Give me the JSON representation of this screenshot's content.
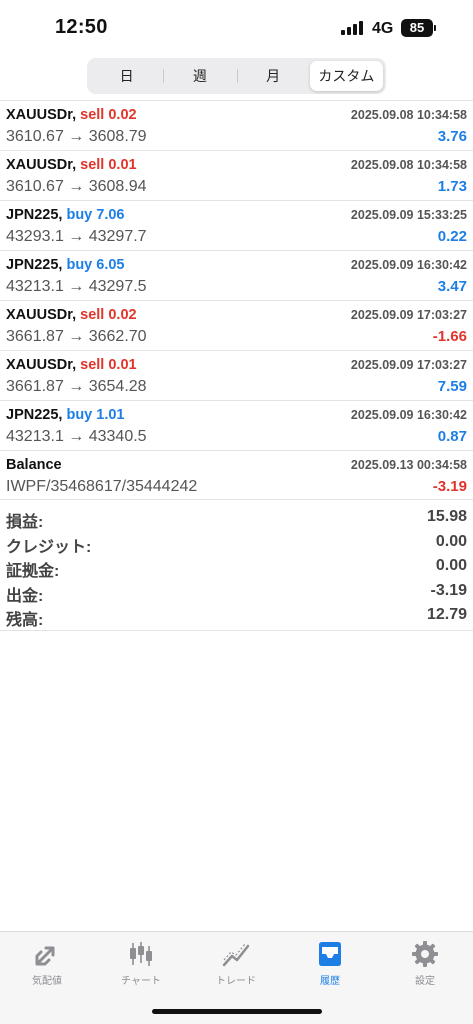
{
  "status": {
    "time": "12:50",
    "network": "4G",
    "battery": "85"
  },
  "period_tabs": [
    "日",
    "週",
    "月",
    "カスタム"
  ],
  "active_period": "カスタム",
  "deals": [
    {
      "symbol": "XAUUSDr,",
      "side": "sell 0.02",
      "side_type": "sell",
      "time": "2025.09.08 10:34:58",
      "prices": "3610.67 → 3608.79",
      "profit": "3.76",
      "profit_sign": "pos"
    },
    {
      "symbol": "XAUUSDr,",
      "side": "sell 0.01",
      "side_type": "sell",
      "time": "2025.09.08 10:34:58",
      "prices": "3610.67 → 3608.94",
      "profit": "1.73",
      "profit_sign": "pos"
    },
    {
      "symbol": "JPN225,",
      "side": "buy 7.06",
      "side_type": "buy",
      "time": "2025.09.09 15:33:25",
      "prices": "43293.1 → 43297.7",
      "profit": "0.22",
      "profit_sign": "pos"
    },
    {
      "symbol": "JPN225,",
      "side": "buy 6.05",
      "side_type": "buy",
      "time": "2025.09.09 16:30:42",
      "prices": "43213.1 → 43297.5",
      "profit": "3.47",
      "profit_sign": "pos"
    },
    {
      "symbol": "XAUUSDr,",
      "side": "sell 0.02",
      "side_type": "sell",
      "time": "2025.09.09 17:03:27",
      "prices": "3661.87 → 3662.70",
      "profit": "-1.66",
      "profit_sign": "neg"
    },
    {
      "symbol": "XAUUSDr,",
      "side": "sell 0.01",
      "side_type": "sell",
      "time": "2025.09.09 17:03:27",
      "prices": "3661.87 → 3654.28",
      "profit": "7.59",
      "profit_sign": "pos"
    },
    {
      "symbol": "JPN225,",
      "side": "buy 1.01",
      "side_type": "buy",
      "time": "2025.09.09 16:30:42",
      "prices": "43213.1 → 43340.5",
      "profit": "0.87",
      "profit_sign": "pos"
    },
    {
      "symbol": "Balance",
      "side": "",
      "side_type": "",
      "time": "2025.09.13 00:34:58",
      "prices": "IWPF/35468617/35444242",
      "profit": "-3.19",
      "profit_sign": "neg"
    }
  ],
  "summary": [
    {
      "label": "損益:",
      "value": "15.98"
    },
    {
      "label": "クレジット:",
      "value": "0.00"
    },
    {
      "label": "証拠金:",
      "value": "0.00"
    },
    {
      "label": "出金:",
      "value": "-3.19"
    },
    {
      "label": "残高:",
      "value": "12.79"
    }
  ],
  "tab_bar": [
    {
      "label": "気配値",
      "icon": "quotes-arrows-icon"
    },
    {
      "label": "チャート",
      "icon": "candlestick-chart-icon"
    },
    {
      "label": "トレード",
      "icon": "trade-line-icon"
    },
    {
      "label": "履歴",
      "icon": "history-inbox-icon"
    },
    {
      "label": "設定",
      "icon": "gear-icon"
    }
  ],
  "active_tab": "履歴",
  "colors": {
    "sell": "#e0352b",
    "buy": "#1d7fe6",
    "positive_profit": "#1d7fe6",
    "negative_profit": "#e0352b",
    "active_tab": "#1d7fe6",
    "inactive_tab": "#8e8e93"
  }
}
